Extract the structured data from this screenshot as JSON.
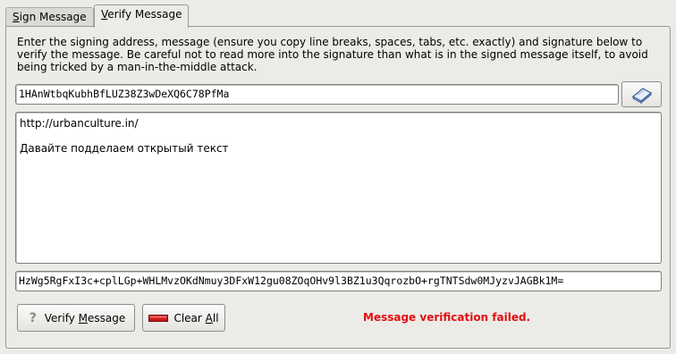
{
  "tabs": {
    "sign": {
      "prefix": "",
      "mnemonic": "S",
      "rest": "ign Message"
    },
    "verify": {
      "prefix": "",
      "mnemonic": "V",
      "rest": "erify Message"
    }
  },
  "description": "Enter the signing address, message (ensure you copy line breaks, spaces, tabs, etc. exactly) and signature below to verify the message. Be careful not to read more into the signature than what is in the signed message itself, to avoid being tricked by a man-in-the-middle attack.",
  "address": {
    "value": "1HAnWtbqKubhBfLUZ38Z3wDeXQ6C78PfMa"
  },
  "message": {
    "lines": [
      "http://urbanculture.in/",
      "",
      "Давайте подделаем открытый текст"
    ]
  },
  "signature": {
    "value": "HzWg5RgFxI3c+cplLGp+WHLMvzOKdNmuy3DFxW12gu08ZOqOHv9l3BZ1u3QqrozbO+rgTNTSdw0MJyzvJAGBk1M="
  },
  "buttons": {
    "verify": {
      "prefix": "Verify ",
      "mnemonic": "M",
      "rest": "essage"
    },
    "clear": {
      "prefix": "Clear ",
      "mnemonic": "A",
      "rest": "ll"
    }
  },
  "status": {
    "text": "Message verification failed.",
    "color": "#e0100f"
  },
  "icons": {
    "address_book": "address-book-icon",
    "help": "question-mark-icon",
    "clear": "eraser-icon"
  }
}
